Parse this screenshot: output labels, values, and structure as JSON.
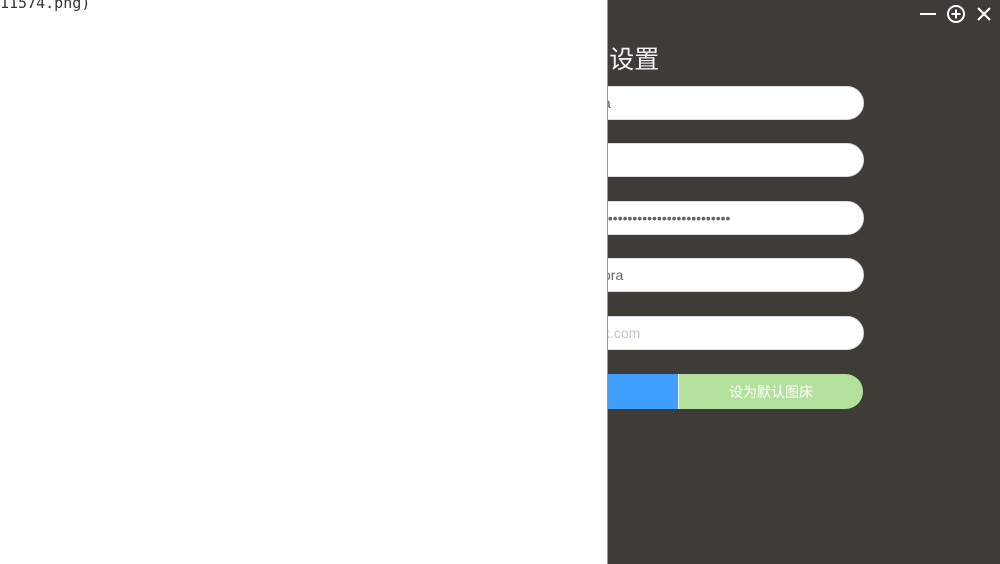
{
  "editor": {
    "code_fragment": "11574.png)"
  },
  "window": {
    "controls": {
      "minimize_icon": "minimize-icon",
      "maximize_icon": "plus-circle-icon",
      "close_icon": "close-icon"
    }
  },
  "panel": {
    "title": "o设置",
    "fields": [
      {
        "value": "a",
        "placeholder": ""
      },
      {
        "value": "",
        "placeholder": ""
      },
      {
        "value": "••••••••••••••••••••••••••",
        "placeholder": ""
      },
      {
        "value": "ora",
        "placeholder": ""
      },
      {
        "value": "",
        "placeholder": "x.com"
      }
    ],
    "buttons": {
      "confirm_label": "",
      "set_default_label": "设为默认图床"
    },
    "colors": {
      "background": "#3f3b37",
      "primary": "#409eff",
      "success_light": "#b3e19d"
    }
  }
}
